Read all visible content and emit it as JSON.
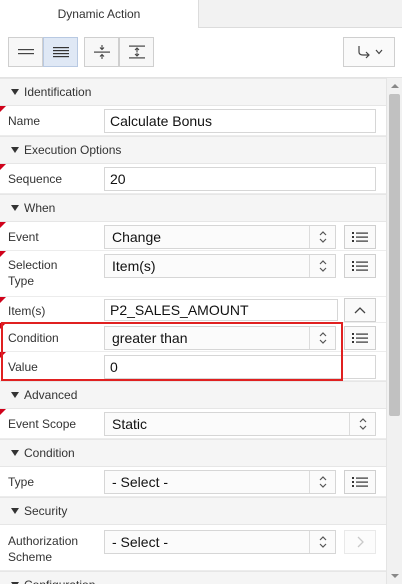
{
  "tabs": [
    {
      "label": "Dynamic Action"
    }
  ],
  "sections": {
    "identification": "Identification",
    "execution": "Execution Options",
    "when": "When",
    "advanced": "Advanced",
    "condition": "Condition",
    "security": "Security",
    "configuration": "Configuration"
  },
  "properties": {
    "name": {
      "label": "Name",
      "value": "Calculate Bonus"
    },
    "sequence": {
      "label": "Sequence",
      "value": "20"
    },
    "event": {
      "label": "Event",
      "value": "Change"
    },
    "selection_type": {
      "label_line1": "Selection",
      "label_line2": "Type",
      "value": "Item(s)"
    },
    "items": {
      "label": "Item(s)",
      "value": "P2_SALES_AMOUNT"
    },
    "condition": {
      "label": "Condition",
      "value": "greater than"
    },
    "value": {
      "label": "Value",
      "value": "0"
    },
    "event_scope": {
      "label": "Event Scope",
      "value": "Static"
    },
    "cond_type": {
      "label": "Type",
      "value": "- Select -"
    },
    "auth_scheme": {
      "label_line1": "Authorization",
      "label_line2": "Scheme",
      "value": "- Select -"
    }
  },
  "icons": {
    "view_compact": "lines-icon",
    "view_list": "list-view-icon",
    "collapse": "collapse-icon",
    "expand": "expand-icon",
    "go_to": "go-to-component-icon"
  },
  "colors": {
    "required": "#d0021b",
    "highlight": "#e02020",
    "active_button": "#dfe8f5"
  }
}
